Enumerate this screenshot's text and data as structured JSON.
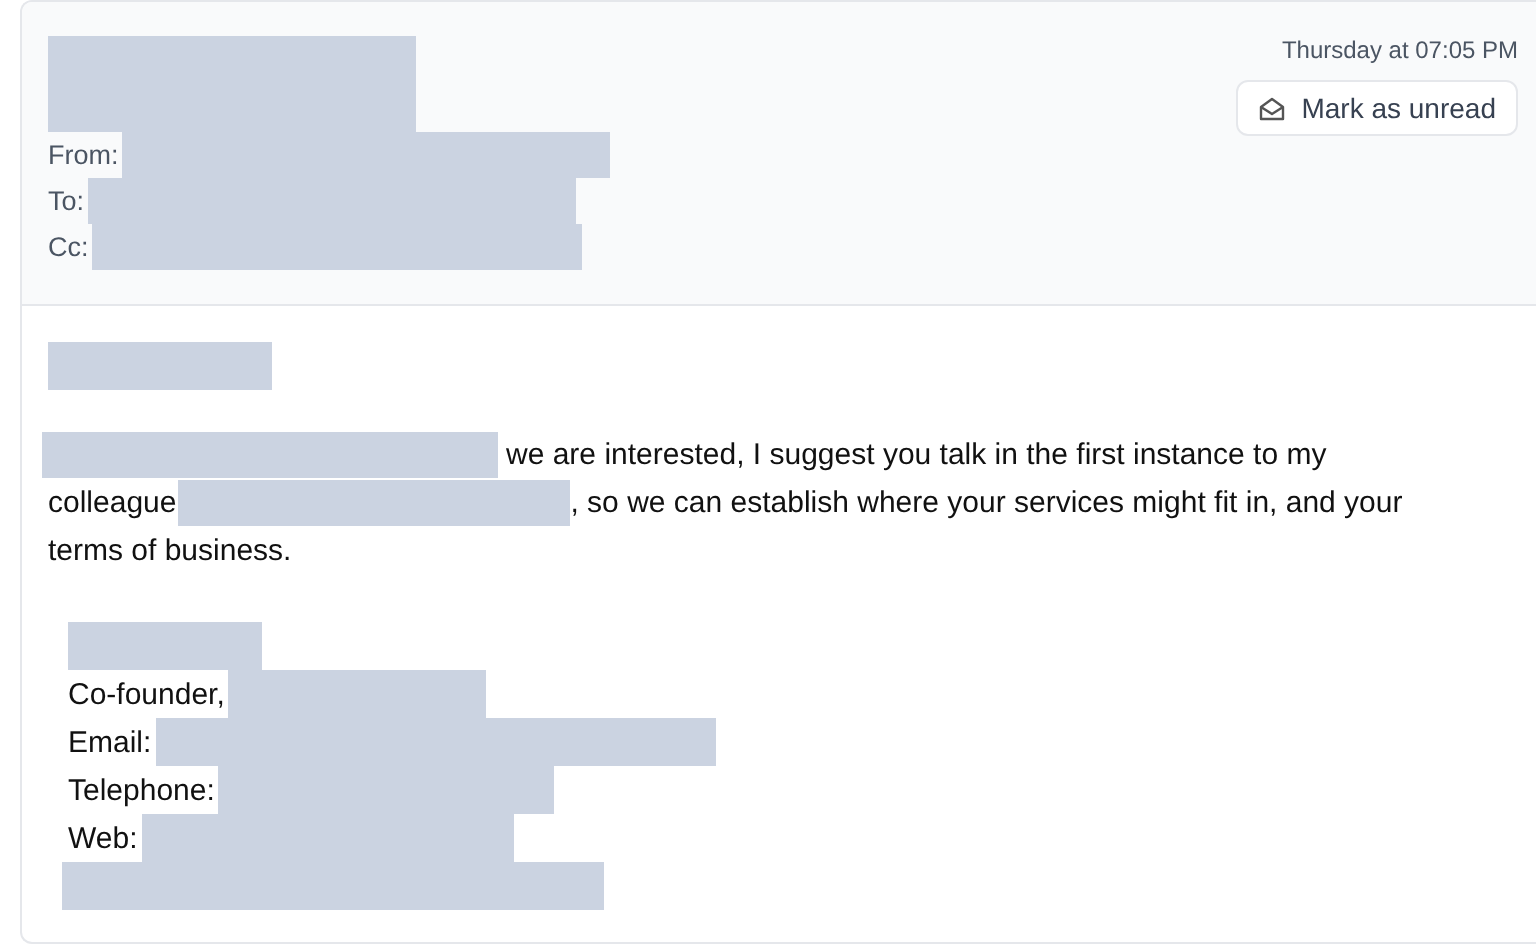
{
  "header": {
    "subject": {
      "kind": "redaction"
    },
    "fields": [
      {
        "label": "From:",
        "value": {
          "kind": "redaction"
        }
      },
      {
        "label": "To:",
        "value": {
          "kind": "redaction"
        }
      },
      {
        "label": "Cc:",
        "value": {
          "kind": "redaction"
        }
      }
    ],
    "timestamp": "Thursday at 07:05 PM",
    "action": "Mark as unread"
  },
  "body": {
    "greeting": {
      "kind": "redaction"
    },
    "paragraph": [
      [
        {
          "kind": "redaction"
        },
        {
          "kind": "text",
          "text": "we are interested, I suggest you talk in the first instance to my"
        }
      ],
      [
        {
          "kind": "text",
          "text": "colleague"
        },
        {
          "kind": "redaction"
        },
        {
          "kind": "text",
          "text": ", so we can establish where your services might fit in, and your"
        }
      ],
      [
        {
          "kind": "text",
          "text": "terms of business."
        }
      ]
    ],
    "signature": [
      [
        {
          "kind": "redaction"
        }
      ],
      [
        {
          "kind": "text",
          "text": "Co-founder,"
        },
        {
          "kind": "redaction"
        }
      ],
      [
        {
          "kind": "text",
          "text": "Email:"
        },
        {
          "kind": "redaction"
        }
      ],
      [
        {
          "kind": "text",
          "text": "Telephone:"
        },
        {
          "kind": "redaction"
        }
      ],
      [
        {
          "kind": "text",
          "text": "Web:"
        },
        {
          "kind": "redaction"
        }
      ],
      [
        {
          "kind": "redaction"
        }
      ]
    ]
  }
}
